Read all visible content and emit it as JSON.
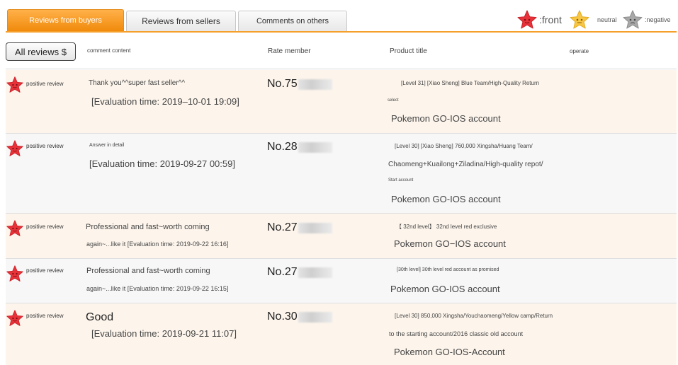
{
  "tabs": [
    {
      "label": "Reviews from buyers",
      "active": true
    },
    {
      "label": "Reviews from sellers",
      "active": false
    },
    {
      "label": "Comments on others",
      "active": false
    }
  ],
  "legend": {
    "front": {
      "label": ":front",
      "color": "#e8323a",
      "icon": "red-star-icon"
    },
    "neutral": {
      "label": "neutral",
      "color": "#f7c744",
      "icon": "yellow-star-icon"
    },
    "negative": {
      "label": ":negative",
      "color": "#a8a8a8",
      "icon": "gray-star-icon"
    }
  },
  "colors": {
    "accent": "#f4a02a",
    "positive_star": "#e8323a"
  },
  "filter_label": "All reviews $",
  "columns": {
    "content": "comment content",
    "rate_member": "Rate member",
    "product_title": "Product title",
    "operate": "operate"
  },
  "reviews": [
    {
      "type": "positive review",
      "content": "Thank you^^super fast seller^^",
      "time": "[Evaluation time: 2019–10-01 19:09]",
      "member": "No.75",
      "product_lines": [
        "[Level 31] [Xiao Sheng] Blue Team/High-Quality Return",
        "select"
      ],
      "product_name": "Pokemon GO-IOS account"
    },
    {
      "type": "positive review",
      "content": "Answer in detail",
      "time": "[Evaluation time: 2019-09-27 00:59]",
      "member": "No.28",
      "product_lines": [
        "[Level 30] [Xiao Sheng] 760,000 Xingsha/Huang Team/",
        "Chaomeng+Kuailong+Ziladina/High-quality repot/",
        "Start account"
      ],
      "product_name": "Pokemon GO-IOS account"
    },
    {
      "type": "positive review",
      "content": "Professional and fast~worth coming",
      "time": "again~...like it [Evaluation time: 2019-09-22 16:16]",
      "member": "No.27",
      "product_lines": [
        "【 32nd level】 32nd level red exclusive"
      ],
      "product_name": "Pokemon GO−IOS account"
    },
    {
      "type": "positive review",
      "content": "Professional and fast~worth coming",
      "time": "again~...like it [Evaluation time: 2019-09-22 16:15]",
      "member": "No.27",
      "product_lines": [
        "[30th level] 30th level red account as promised"
      ],
      "product_name": "Pokemon GO-IOS account"
    },
    {
      "type": "positive review",
      "content": "Good",
      "time": "[Evaluation time: 2019-09-21 11:07]",
      "member": "No.30",
      "product_lines": [
        "[Level 30] 850,000 Xingsha/Youchaomeng/Yellow camp/Return",
        "to the starting account/2016 classic old account"
      ],
      "product_name": "Pokemon GO-IOS-Account"
    }
  ]
}
